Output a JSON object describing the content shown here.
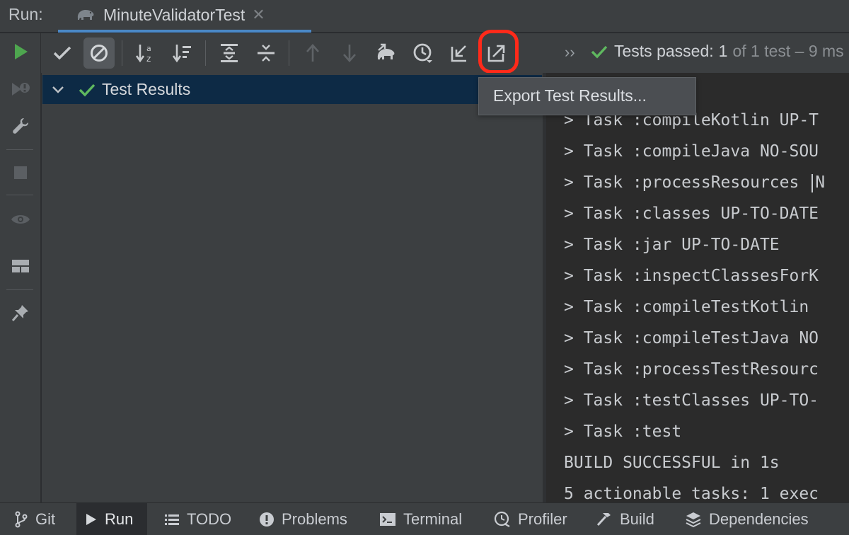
{
  "run_bar": {
    "label": "Run:",
    "tab_title": "MinuteValidatorTest",
    "tab_icon": "gradle-elephant-icon",
    "close_icon": "close-icon"
  },
  "toolbar": {
    "buttons": [
      {
        "name": "show-passed-button",
        "icon": "check-icon"
      },
      {
        "name": "show-ignored-button",
        "icon": "no-entry-icon",
        "active": true
      },
      {
        "name": "sort-alphabetically-button",
        "icon": "sort-az-icon"
      },
      {
        "name": "sort-by-duration-button",
        "icon": "sort-duration-icon"
      },
      {
        "name": "expand-all-button",
        "icon": "expand-all-icon"
      },
      {
        "name": "collapse-all-button",
        "icon": "collapse-all-icon"
      },
      {
        "name": "previous-failed-button",
        "icon": "arrow-up-icon"
      },
      {
        "name": "next-failed-button",
        "icon": "arrow-down-icon"
      },
      {
        "name": "import-gradle-results-button",
        "icon": "elephant-arrow-icon"
      },
      {
        "name": "test-history-button",
        "icon": "clock-icon"
      },
      {
        "name": "import-tests-button",
        "icon": "import-icon"
      },
      {
        "name": "export-test-results-button",
        "icon": "export-icon",
        "highlighted": true
      }
    ],
    "more_label": "››",
    "status": {
      "prefix": "Tests passed:",
      "count": "1",
      "suffix": "of 1 test – 9 ms"
    }
  },
  "left_strip": [
    "rerun-icon",
    "rerun-failed-icon",
    "wrench-icon",
    "stop-icon",
    "eye-icon",
    "layout-icon",
    "pin-icon"
  ],
  "tree": {
    "root_label": "Test Results"
  },
  "tooltip": {
    "text": "Export Test Results..."
  },
  "console": {
    "lines": [
      "> Task :compileKotlin UP-T",
      "> Task :compileJava NO-SOU",
      "> Task :processResources ",
      "> Task :classes UP-TO-DATE",
      "> Task :jar UP-TO-DATE",
      "> Task :inspectClassesForK",
      "> Task :compileTestKotlin ",
      "> Task :compileTestJava NO",
      "> Task :processTestResourc",
      "> Task :testClasses UP-TO-",
      "> Task :test",
      "BUILD SUCCESSFUL in 1s",
      "5 actionable tasks: 1 exec"
    ],
    "caret_tail": "N"
  },
  "bottom_tabs": [
    {
      "label": "Git",
      "icon": "git-branch-icon"
    },
    {
      "label": "Run",
      "icon": "run-icon",
      "active": true
    },
    {
      "label": "TODO",
      "icon": "list-icon"
    },
    {
      "label": "Problems",
      "icon": "problems-icon"
    },
    {
      "label": "Terminal",
      "icon": "terminal-icon"
    },
    {
      "label": "Profiler",
      "icon": "profiler-icon"
    },
    {
      "label": "Build",
      "icon": "hammer-icon"
    },
    {
      "label": "Dependencies",
      "icon": "layers-icon"
    }
  ],
  "colors": {
    "pass_green": "#5fb85f",
    "run_green": "#4ea64f",
    "highlight_red": "#ff2a1a",
    "selection_blue": "#0d2a45",
    "tab_underline": "#4a88c7"
  }
}
